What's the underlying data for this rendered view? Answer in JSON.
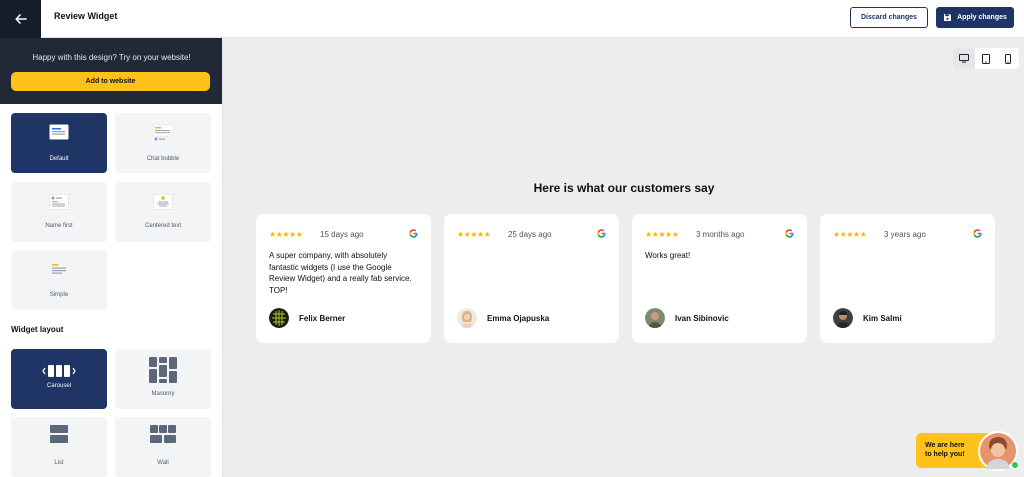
{
  "header": {
    "title": "Review Widget",
    "discard_label": "Discard changes",
    "apply_label": "Apply changes"
  },
  "sidebar": {
    "promo_text": "Happy with this design? Try on your website!",
    "add_button": "Add to website",
    "styles": [
      {
        "label": "Default",
        "active": true
      },
      {
        "label": "Chat bubble",
        "active": false
      },
      {
        "label": "Name first",
        "active": false
      },
      {
        "label": "Centered text",
        "active": false
      },
      {
        "label": "Simple",
        "active": false
      }
    ],
    "layout_title": "Widget layout",
    "layouts": [
      {
        "label": "Carousel",
        "active": true
      },
      {
        "label": "Masonry",
        "active": false
      },
      {
        "label": "List",
        "active": false
      },
      {
        "label": "Wall",
        "active": false
      }
    ]
  },
  "preview": {
    "devices": [
      {
        "icon": "desktop-icon",
        "active": true
      },
      {
        "icon": "tablet-icon",
        "active": false
      },
      {
        "icon": "mobile-icon",
        "active": false
      }
    ],
    "heading": "Here is what our customers say",
    "reviews": [
      {
        "stars": "★★★★★",
        "rating": 5,
        "date": "15 days ago",
        "text": "A super company, with absolutely fantastic widgets (I use the Google Review Widget) and a really fab service. TOP!",
        "author": "Felix Berner"
      },
      {
        "stars": "★★★★★",
        "rating": 5,
        "date": "25 days ago",
        "text": "",
        "author": "Emma Ojapuska"
      },
      {
        "stars": "★★★★★",
        "rating": 5,
        "date": "3 months ago",
        "text": "Works great!",
        "author": "Ivan Sibinovic"
      },
      {
        "stars": "★★★★★",
        "rating": 5,
        "date": "3 years ago",
        "text": "",
        "author": "Kim Salmi"
      }
    ],
    "chat": {
      "line1": "We are here",
      "line2": "to help you!"
    }
  },
  "colors": {
    "navy": "#1d3566",
    "dark": "#212937",
    "accent": "#ffc21a",
    "star": "#f4b800",
    "background": "#ededee"
  }
}
